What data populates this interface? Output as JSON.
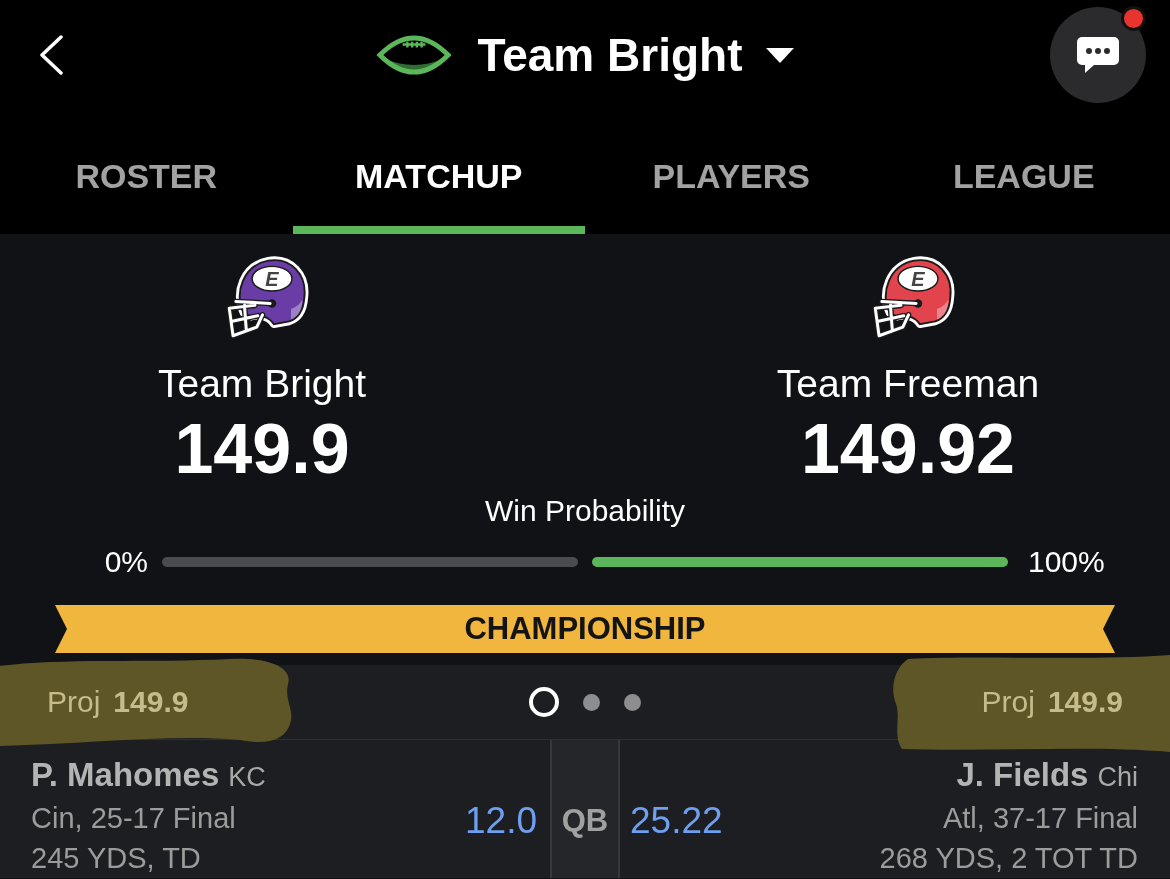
{
  "header": {
    "title": "Team Bright",
    "unread": true
  },
  "tabs": [
    {
      "label": "ROSTER",
      "selected": false
    },
    {
      "label": "MATCHUP",
      "selected": true
    },
    {
      "label": "PLAYERS",
      "selected": false
    },
    {
      "label": "LEAGUE",
      "selected": false
    }
  ],
  "teams": [
    {
      "name": "Team Bright",
      "score": "149.9",
      "logo_letter": "E",
      "color": "#6a3da6"
    },
    {
      "name": "Team Freeman",
      "score": "149.92",
      "logo_letter": "E",
      "color": "#e2444e"
    }
  ],
  "win_probability": {
    "label": "Win Probability",
    "bars": [
      {
        "reading": "0%",
        "favored": false
      },
      {
        "reading": "100%",
        "favored": true
      }
    ]
  },
  "banner": {
    "title": "CHAMPIONSHIP"
  },
  "projections": [
    {
      "label": "Proj",
      "value": "149.9",
      "highlighted": true
    },
    {
      "label": "Proj",
      "value": "149.9",
      "highlighted": true
    }
  ],
  "pager": [
    {
      "selected": true
    },
    {
      "selected": false
    },
    {
      "selected": false
    }
  ],
  "matchups": [
    {
      "position": "QB",
      "left": {
        "name": "P. Mahomes",
        "team": "KC",
        "game": "Cin, 25-17 Final",
        "stats": "245 YDS, TD",
        "points": "12.0"
      },
      "right": {
        "name": "J. Fields",
        "team": "Chi",
        "game": "Atl, 37-17 Final",
        "stats": "268 YDS, 2 TOT TD",
        "points": "25.22"
      }
    }
  ]
}
